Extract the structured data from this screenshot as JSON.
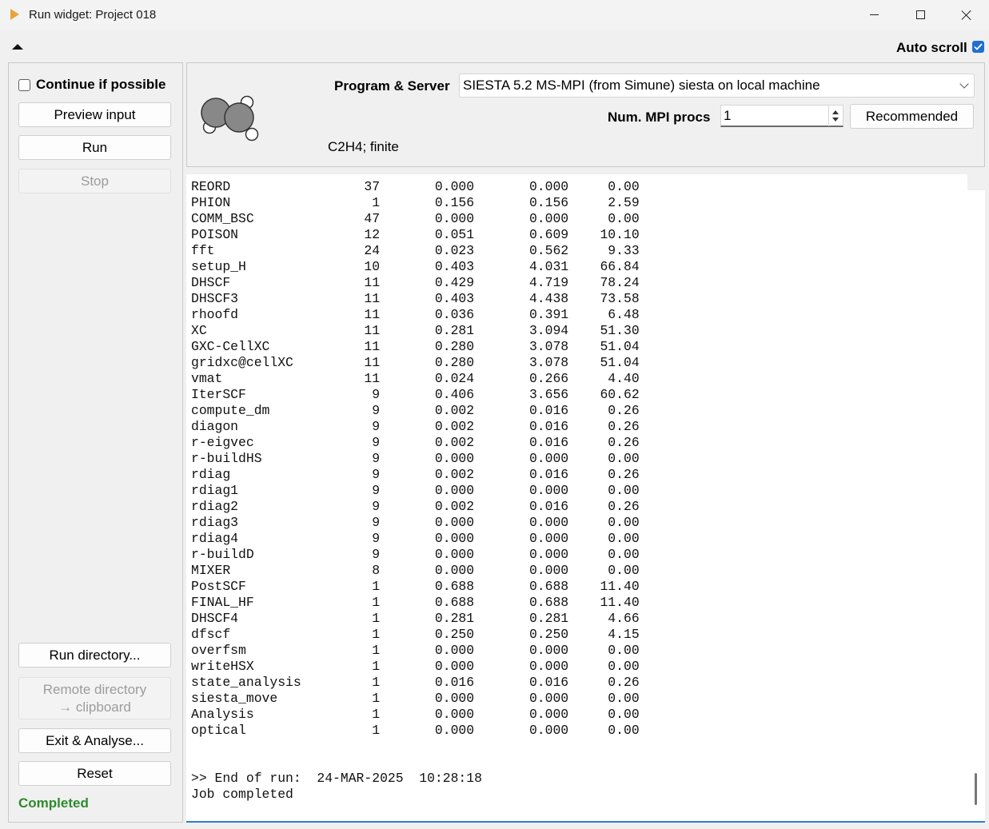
{
  "window": {
    "title": "Run widget: Project 018"
  },
  "top": {
    "auto_scroll_label": "Auto scroll",
    "auto_scroll_checked": true
  },
  "left": {
    "continue_label": "Continue if possible",
    "preview_input": "Preview input",
    "run": "Run",
    "stop": "Stop",
    "run_directory": "Run directory...",
    "remote_directory_line1": "Remote directory",
    "remote_directory_line2": "→ clipboard",
    "exit_analyse": "Exit & Analyse...",
    "reset": "Reset",
    "status": "Completed"
  },
  "program": {
    "label": "Program & Server",
    "selected": "SIESTA 5.2 MS-MPI (from Simune) siesta on local machine",
    "mpi_label": "Num. MPI procs",
    "mpi_value": "1",
    "recommended": "Recommended",
    "subtitle": "C2H4; finite"
  },
  "log": {
    "rows": [
      [
        "REORD",
        "37",
        "0.000",
        "0.000",
        "0.00"
      ],
      [
        "PHION",
        "1",
        "0.156",
        "0.156",
        "2.59"
      ],
      [
        "COMM_BSC",
        "47",
        "0.000",
        "0.000",
        "0.00"
      ],
      [
        "POISON",
        "12",
        "0.051",
        "0.609",
        "10.10"
      ],
      [
        "fft",
        "24",
        "0.023",
        "0.562",
        "9.33"
      ],
      [
        "setup_H",
        "10",
        "0.403",
        "4.031",
        "66.84"
      ],
      [
        "DHSCF",
        "11",
        "0.429",
        "4.719",
        "78.24"
      ],
      [
        "DHSCF3",
        "11",
        "0.403",
        "4.438",
        "73.58"
      ],
      [
        "rhoofd",
        "11",
        "0.036",
        "0.391",
        "6.48"
      ],
      [
        "XC",
        "11",
        "0.281",
        "3.094",
        "51.30"
      ],
      [
        "GXC-CellXC",
        "11",
        "0.280",
        "3.078",
        "51.04"
      ],
      [
        "gridxc@cellXC",
        "11",
        "0.280",
        "3.078",
        "51.04"
      ],
      [
        "vmat",
        "11",
        "0.024",
        "0.266",
        "4.40"
      ],
      [
        "IterSCF",
        "9",
        "0.406",
        "3.656",
        "60.62"
      ],
      [
        "compute_dm",
        "9",
        "0.002",
        "0.016",
        "0.26"
      ],
      [
        "diagon",
        "9",
        "0.002",
        "0.016",
        "0.26"
      ],
      [
        "r-eigvec",
        "9",
        "0.002",
        "0.016",
        "0.26"
      ],
      [
        "r-buildHS",
        "9",
        "0.000",
        "0.000",
        "0.00"
      ],
      [
        "rdiag",
        "9",
        "0.002",
        "0.016",
        "0.26"
      ],
      [
        "rdiag1",
        "9",
        "0.000",
        "0.000",
        "0.00"
      ],
      [
        "rdiag2",
        "9",
        "0.002",
        "0.016",
        "0.26"
      ],
      [
        "rdiag3",
        "9",
        "0.000",
        "0.000",
        "0.00"
      ],
      [
        "rdiag4",
        "9",
        "0.000",
        "0.000",
        "0.00"
      ],
      [
        "r-buildD",
        "9",
        "0.000",
        "0.000",
        "0.00"
      ],
      [
        "MIXER",
        "8",
        "0.000",
        "0.000",
        "0.00"
      ],
      [
        "PostSCF",
        "1",
        "0.688",
        "0.688",
        "11.40"
      ],
      [
        "FINAL_HF",
        "1",
        "0.688",
        "0.688",
        "11.40"
      ],
      [
        "DHSCF4",
        "1",
        "0.281",
        "0.281",
        "4.66"
      ],
      [
        "dfscf",
        "1",
        "0.250",
        "0.250",
        "4.15"
      ],
      [
        "overfsm",
        "1",
        "0.000",
        "0.000",
        "0.00"
      ],
      [
        "writeHSX",
        "1",
        "0.000",
        "0.000",
        "0.00"
      ],
      [
        "state_analysis",
        "1",
        "0.016",
        "0.016",
        "0.26"
      ],
      [
        "siesta_move",
        "1",
        "0.000",
        "0.000",
        "0.00"
      ],
      [
        "Analysis",
        "1",
        "0.000",
        "0.000",
        "0.00"
      ],
      [
        "optical",
        "1",
        "0.000",
        "0.000",
        "0.00"
      ]
    ],
    "end_lines": [
      ">> End of run:  24-MAR-2025  10:28:18",
      "Job completed"
    ]
  }
}
